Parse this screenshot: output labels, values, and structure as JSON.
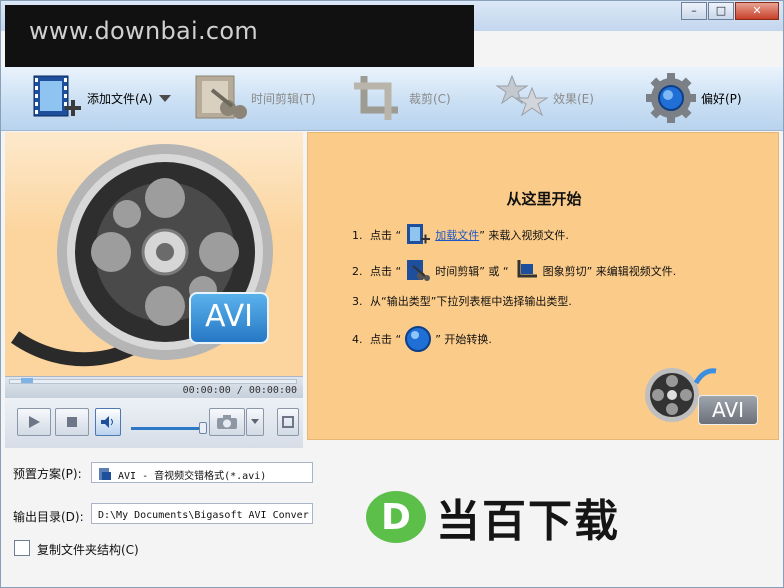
{
  "watermark": "www.downbai.com",
  "window_controls": {
    "minimize": "–",
    "maximize": "□",
    "close": "✕"
  },
  "toolbar": {
    "add_file": "添加文件(A)",
    "trim": "时间剪辑(T)",
    "crop": "裁剪(C)",
    "effect": "效果(E)",
    "preferences": "偏好(P)"
  },
  "preview": {
    "badge": "AVI",
    "timecode": "00:00:00 / 00:00:00",
    "seek_progress": 0.04,
    "volume_level": 0.95
  },
  "guide": {
    "title": "从这里开始",
    "step1": {
      "num": "1.",
      "pre": "点击 “",
      "link": "加载文件",
      "post": "” 来载入视频文件."
    },
    "step2": {
      "num": "2.",
      "pre": "点击 “",
      "mid1": "时间剪辑” 或 “",
      "post": "图象剪切” 来编辑视频文件."
    },
    "step3": {
      "num": "3.",
      "text": "从“输出类型”下拉列表框中选择输出类型."
    },
    "step4": {
      "num": "4.",
      "pre": "点击 “",
      "post": "” 开始转换."
    },
    "badge": "AVI"
  },
  "form": {
    "preset_label": "预置方案(P):",
    "preset_value": "AVI - 音视频交错格式(*.avi)",
    "output_label": "输出目录(D):",
    "output_value": "D:\\My Documents\\Bigasoft AVI Conver",
    "copy_structure_label": "复制文件夹结构(C)"
  },
  "logo": {
    "letter": "D",
    "text": "当百下载"
  },
  "colors": {
    "accent": "#2d79c7",
    "panel": "#fbcb89",
    "logo_green": "#5cbf4a"
  }
}
